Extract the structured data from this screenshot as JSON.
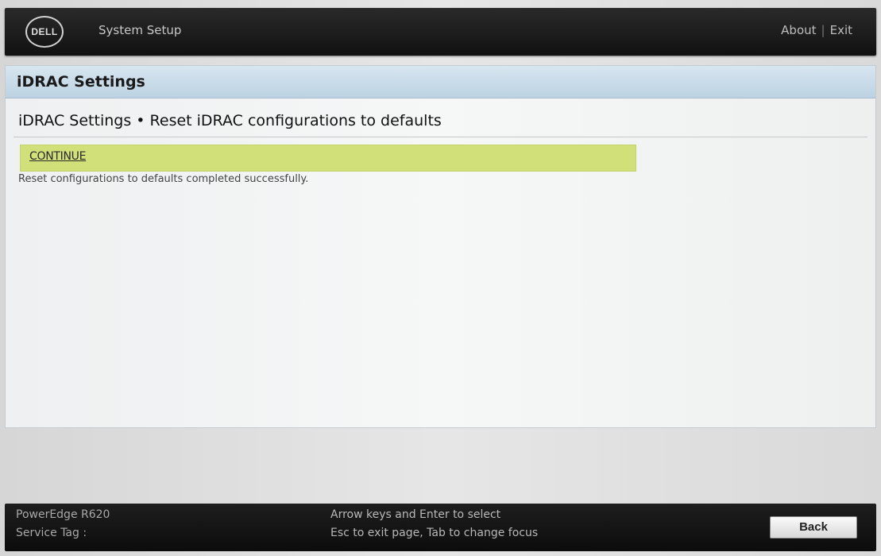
{
  "header": {
    "logo_text": "DELL",
    "app_title": "System Setup",
    "links": [
      "About",
      "Exit"
    ]
  },
  "panel": {
    "title": "iDRAC Settings",
    "page_heading": "iDRAC Settings • Reset iDRAC configurations to defaults",
    "continue_label": "CONTINUE",
    "status_message": "Reset configurations to defaults completed successfully.",
    "continue_highlight_color": "#d2e07a"
  },
  "footer": {
    "model": "PowerEdge R620",
    "service_tag_label": "Service Tag :",
    "hint_line1": "Arrow keys and Enter to select",
    "hint_line2": "Esc to exit page, Tab to change focus",
    "back_label": "Back"
  }
}
